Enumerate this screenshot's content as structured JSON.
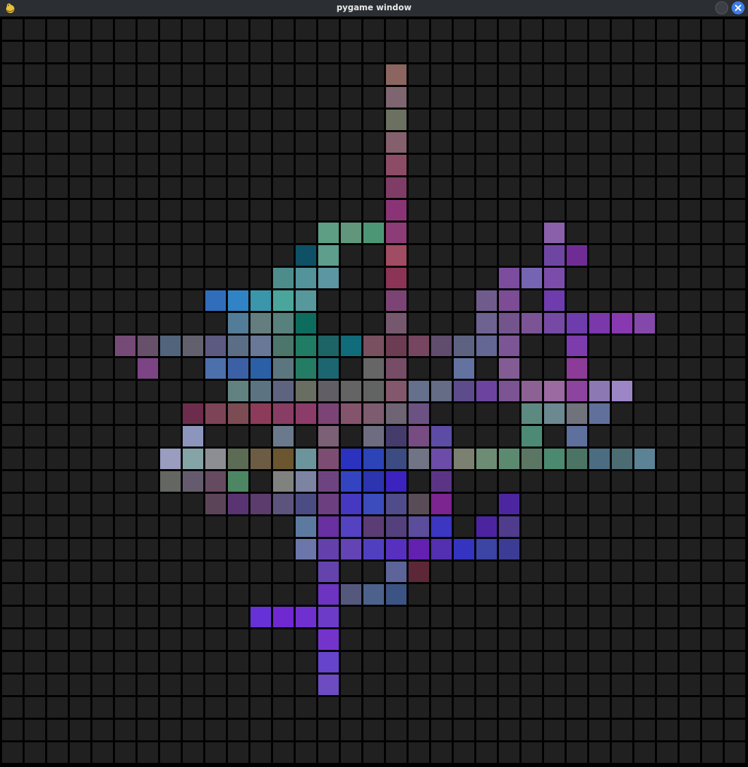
{
  "window": {
    "title": "pygame window",
    "icons": {
      "app": "pygame-snake-icon",
      "minimize": "minimize-icon",
      "close": "close-icon"
    },
    "colors": {
      "titlebar": "#2b2e33",
      "close_button": "#3d7de8",
      "empty_cell": "#202020",
      "grid_line": "#000000"
    }
  },
  "grid": {
    "cols": 33,
    "rows": 33,
    "empty_color": "#202020",
    "cells": [
      [
        17,
        2,
        "#8c6560"
      ],
      [
        17,
        3,
        "#7e6570"
      ],
      [
        17,
        4,
        "#6b7060"
      ],
      [
        17,
        5,
        "#84606c"
      ],
      [
        17,
        6,
        "#8c4c66"
      ],
      [
        17,
        7,
        "#7e3c66"
      ],
      [
        17,
        8,
        "#8a3476"
      ],
      [
        14,
        9,
        "#5e9e84"
      ],
      [
        15,
        9,
        "#62967c"
      ],
      [
        16,
        9,
        "#4c9676"
      ],
      [
        17,
        9,
        "#8c3c76"
      ],
      [
        24,
        9,
        "#8a60aa"
      ],
      [
        13,
        10,
        "#0e5066"
      ],
      [
        14,
        10,
        "#5e9e8c"
      ],
      [
        17,
        10,
        "#a04c62"
      ],
      [
        24,
        10,
        "#6e46a2"
      ],
      [
        25,
        10,
        "#6e2c94"
      ],
      [
        12,
        11,
        "#4e8c8c"
      ],
      [
        13,
        11,
        "#52949a"
      ],
      [
        14,
        11,
        "#5c96a2"
      ],
      [
        17,
        11,
        "#8c3456"
      ],
      [
        22,
        11,
        "#7c4c9e"
      ],
      [
        23,
        11,
        "#7464b2"
      ],
      [
        24,
        11,
        "#7c4caa"
      ],
      [
        9,
        12,
        "#306ebb"
      ],
      [
        10,
        12,
        "#3084c6"
      ],
      [
        11,
        12,
        "#3a96aa"
      ],
      [
        12,
        12,
        "#4aa69c"
      ],
      [
        13,
        12,
        "#56989c"
      ],
      [
        17,
        12,
        "#7c4474"
      ],
      [
        21,
        12,
        "#705c8c"
      ],
      [
        22,
        12,
        "#7c4c94"
      ],
      [
        24,
        12,
        "#6e3cac"
      ],
      [
        10,
        13,
        "#527c98"
      ],
      [
        11,
        13,
        "#647e80"
      ],
      [
        12,
        13,
        "#58807c"
      ],
      [
        13,
        13,
        "#0e6c5e"
      ],
      [
        17,
        13,
        "#76586e"
      ],
      [
        21,
        13,
        "#6e6290"
      ],
      [
        22,
        13,
        "#74548c"
      ],
      [
        23,
        13,
        "#7a5494"
      ],
      [
        24,
        13,
        "#764aa4"
      ],
      [
        25,
        13,
        "#6e3cac"
      ],
      [
        26,
        13,
        "#7a38aa"
      ],
      [
        27,
        13,
        "#8838b0"
      ],
      [
        28,
        13,
        "#8448aa"
      ],
      [
        5,
        14,
        "#764a76"
      ],
      [
        6,
        14,
        "#66506a"
      ],
      [
        7,
        14,
        "#52647c"
      ],
      [
        8,
        14,
        "#62606c"
      ],
      [
        9,
        14,
        "#5c5a80"
      ],
      [
        10,
        14,
        "#5c6e86"
      ],
      [
        11,
        14,
        "#6a7898"
      ],
      [
        12,
        14,
        "#4c766c"
      ],
      [
        13,
        14,
        "#207c64"
      ],
      [
        14,
        14,
        "#1c6466"
      ],
      [
        15,
        14,
        "#106c7a"
      ],
      [
        16,
        14,
        "#785060"
      ],
      [
        17,
        14,
        "#6c3c52"
      ],
      [
        18,
        14,
        "#764660"
      ],
      [
        19,
        14,
        "#604c6c"
      ],
      [
        20,
        14,
        "#5c6280"
      ],
      [
        21,
        14,
        "#646694"
      ],
      [
        22,
        14,
        "#7c5694"
      ],
      [
        25,
        14,
        "#7c3cac"
      ],
      [
        6,
        15,
        "#7c4484"
      ],
      [
        9,
        15,
        "#4c70ac"
      ],
      [
        10,
        15,
        "#3c60a6"
      ],
      [
        11,
        15,
        "#2c60a6"
      ],
      [
        12,
        15,
        "#5c7680"
      ],
      [
        13,
        15,
        "#247c64"
      ],
      [
        14,
        15,
        "#1c6672"
      ],
      [
        16,
        15,
        "#666666"
      ],
      [
        17,
        15,
        "#764c66"
      ],
      [
        20,
        15,
        "#6472a0"
      ],
      [
        22,
        15,
        "#845c94"
      ],
      [
        25,
        15,
        "#8c3c98"
      ],
      [
        10,
        16,
        "#628282"
      ],
      [
        11,
        16,
        "#5c7482"
      ],
      [
        12,
        16,
        "#5e6480"
      ],
      [
        13,
        16,
        "#686e62"
      ],
      [
        14,
        16,
        "#625e66"
      ],
      [
        15,
        16,
        "#646464"
      ],
      [
        16,
        16,
        "#626464"
      ],
      [
        17,
        16,
        "#84586c"
      ],
      [
        18,
        16,
        "#64708c"
      ],
      [
        19,
        16,
        "#646c86"
      ],
      [
        20,
        16,
        "#5c4c8c"
      ],
      [
        21,
        16,
        "#6c44a0"
      ],
      [
        22,
        16,
        "#7c5494"
      ],
      [
        23,
        16,
        "#8c6294"
      ],
      [
        24,
        16,
        "#9a6aa0"
      ],
      [
        25,
        16,
        "#8c44a0"
      ],
      [
        26,
        16,
        "#8c78b2"
      ],
      [
        27,
        16,
        "#9c86c6"
      ],
      [
        8,
        17,
        "#6c2c4c"
      ],
      [
        9,
        17,
        "#7c4456"
      ],
      [
        10,
        17,
        "#7c4c54"
      ],
      [
        11,
        17,
        "#8c3c5a"
      ],
      [
        12,
        17,
        "#883e64"
      ],
      [
        13,
        17,
        "#8c3c68"
      ],
      [
        14,
        17,
        "#7c4476"
      ],
      [
        15,
        17,
        "#84546c"
      ],
      [
        16,
        17,
        "#7c5c6e"
      ],
      [
        17,
        17,
        "#6e6474"
      ],
      [
        18,
        17,
        "#6c5282"
      ],
      [
        23,
        17,
        "#5c8a80"
      ],
      [
        24,
        17,
        "#6c8890"
      ],
      [
        25,
        17,
        "#70727c"
      ],
      [
        26,
        17,
        "#60709a"
      ],
      [
        8,
        18,
        "#8c96bc"
      ],
      [
        12,
        18,
        "#6a7a8c"
      ],
      [
        14,
        18,
        "#7c6076"
      ],
      [
        16,
        18,
        "#6e6c80"
      ],
      [
        17,
        18,
        "#463c6c"
      ],
      [
        18,
        18,
        "#764c82"
      ],
      [
        19,
        18,
        "#5c4ca4"
      ],
      [
        23,
        18,
        "#4c8a76"
      ],
      [
        25,
        18,
        "#60709c"
      ],
      [
        7,
        19,
        "#9a9cc0"
      ],
      [
        8,
        19,
        "#84a4a6"
      ],
      [
        9,
        19,
        "#8c8e94"
      ],
      [
        10,
        19,
        "#5c6c54"
      ],
      [
        11,
        19,
        "#6c5c44"
      ],
      [
        12,
        19,
        "#6c5630"
      ],
      [
        13,
        19,
        "#6c949c"
      ],
      [
        14,
        19,
        "#7c4c72"
      ],
      [
        15,
        19,
        "#2c32c0"
      ],
      [
        16,
        19,
        "#2c44b8"
      ],
      [
        17,
        19,
        "#3c4c82"
      ],
      [
        18,
        19,
        "#707484"
      ],
      [
        19,
        19,
        "#6c4ca8"
      ],
      [
        20,
        19,
        "#7c8070"
      ],
      [
        21,
        19,
        "#6c8c74"
      ],
      [
        22,
        19,
        "#5c8a70"
      ],
      [
        23,
        19,
        "#5c7664"
      ],
      [
        24,
        19,
        "#4c8a70"
      ],
      [
        25,
        19,
        "#4c7464"
      ],
      [
        26,
        19,
        "#4c6c82"
      ],
      [
        27,
        19,
        "#4c6c74"
      ],
      [
        28,
        19,
        "#5c8296"
      ],
      [
        7,
        20,
        "#646662"
      ],
      [
        8,
        20,
        "#645c6e"
      ],
      [
        9,
        20,
        "#664a60"
      ],
      [
        10,
        20,
        "#4c8662"
      ],
      [
        12,
        20,
        "#808280"
      ],
      [
        13,
        20,
        "#7c84a2"
      ],
      [
        14,
        20,
        "#6e4480"
      ],
      [
        15,
        20,
        "#3444c0"
      ],
      [
        16,
        20,
        "#2c34b0"
      ],
      [
        17,
        20,
        "#3c22be"
      ],
      [
        19,
        20,
        "#5c3486"
      ],
      [
        9,
        21,
        "#5c4458"
      ],
      [
        10,
        21,
        "#5a3472"
      ],
      [
        11,
        21,
        "#5c3c6c"
      ],
      [
        12,
        21,
        "#5c547c"
      ],
      [
        13,
        21,
        "#4c4c84"
      ],
      [
        14,
        21,
        "#6c4080"
      ],
      [
        15,
        21,
        "#4638c0"
      ],
      [
        16,
        21,
        "#3c4cbc"
      ],
      [
        17,
        21,
        "#504c8c"
      ],
      [
        18,
        21,
        "#5a4c56"
      ],
      [
        19,
        21,
        "#7c2490"
      ],
      [
        22,
        21,
        "#4c26a0"
      ],
      [
        13,
        22,
        "#5c7aa0"
      ],
      [
        14,
        22,
        "#6830a0"
      ],
      [
        15,
        22,
        "#5442c0"
      ],
      [
        16,
        22,
        "#5c3c74"
      ],
      [
        17,
        22,
        "#54407c"
      ],
      [
        18,
        22,
        "#5c4c9c"
      ],
      [
        19,
        22,
        "#3c36c0"
      ],
      [
        21,
        22,
        "#4c24a0"
      ],
      [
        22,
        22,
        "#503c8c"
      ],
      [
        13,
        23,
        "#6c76aa"
      ],
      [
        14,
        23,
        "#6440ac"
      ],
      [
        15,
        23,
        "#6444b4"
      ],
      [
        16,
        23,
        "#5040c0"
      ],
      [
        17,
        23,
        "#5830c0"
      ],
      [
        18,
        23,
        "#6420b0"
      ],
      [
        19,
        23,
        "#5230b0"
      ],
      [
        20,
        23,
        "#3434c0"
      ],
      [
        21,
        23,
        "#3c44a4"
      ],
      [
        22,
        23,
        "#3c3c94"
      ],
      [
        14,
        24,
        "#6444ac"
      ],
      [
        17,
        24,
        "#5c649a"
      ],
      [
        18,
        24,
        "#5c2838"
      ],
      [
        14,
        25,
        "#6c34c0"
      ],
      [
        15,
        25,
        "#54587c"
      ],
      [
        16,
        25,
        "#4c628c"
      ],
      [
        17,
        25,
        "#3c5484"
      ],
      [
        11,
        26,
        "#6632d8"
      ],
      [
        12,
        26,
        "#7028d0"
      ],
      [
        13,
        26,
        "#7030d0"
      ],
      [
        14,
        26,
        "#6c3cc8"
      ],
      [
        14,
        27,
        "#7434cc"
      ],
      [
        14,
        28,
        "#6644cc"
      ],
      [
        14,
        29,
        "#6c4cc0"
      ]
    ]
  }
}
